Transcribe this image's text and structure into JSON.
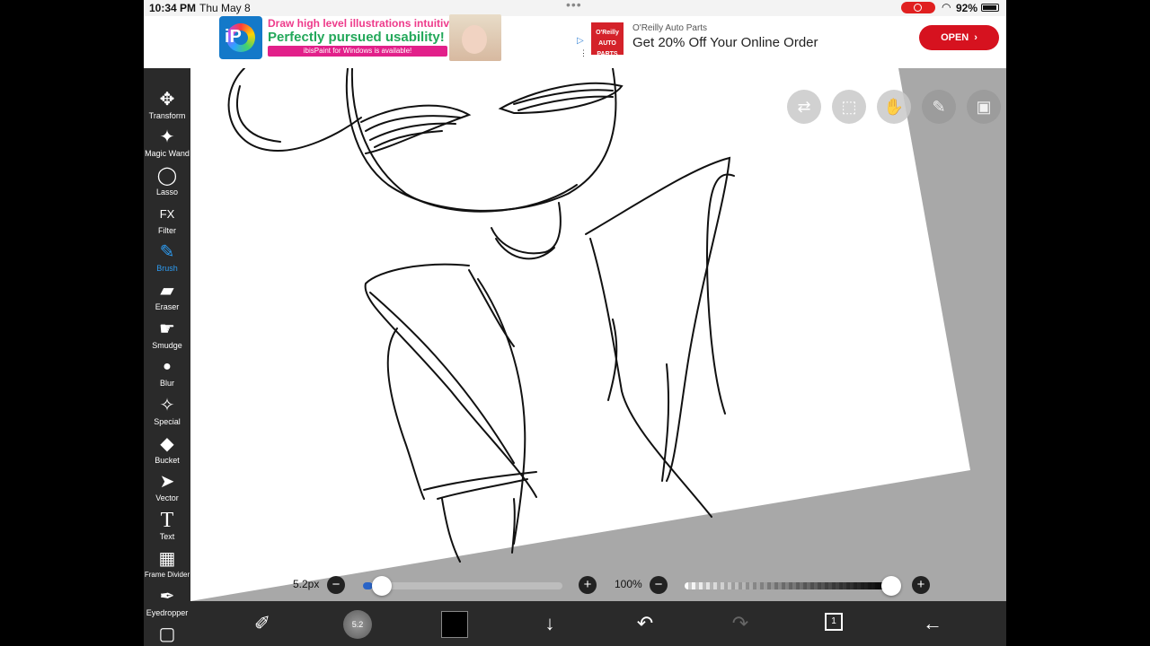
{
  "status_bar": {
    "time": "10:34 PM",
    "date": "Thu May 8",
    "battery": "92%",
    "icons": [
      "screen-record-icon",
      "wifi-icon",
      "battery-icon"
    ]
  },
  "ads": {
    "left": {
      "line1": "Draw high level illustrations intuitively!",
      "line2": "Perfectly pursued usability!",
      "line3": "ibisPaint for Windows is available!",
      "logo_text": "iP"
    },
    "right": {
      "brand": "O'Reilly Auto Parts",
      "offer": "Get 20% Off Your Online Order",
      "button": "OPEN",
      "logo_text": "O'Reilly AUTO PARTS"
    }
  },
  "toolbar": {
    "tools": [
      {
        "label": "Transform",
        "icon": "move-arrows-icon",
        "glyph": "✥"
      },
      {
        "label": "Magic Wand",
        "icon": "magic-wand-icon",
        "glyph": "✦"
      },
      {
        "label": "Lasso",
        "icon": "lasso-icon",
        "glyph": "◯"
      },
      {
        "label": "Filter",
        "icon": "fx-icon",
        "glyph": "FX"
      },
      {
        "label": "Brush",
        "icon": "brush-icon",
        "glyph": "✎",
        "active": true
      },
      {
        "label": "Eraser",
        "icon": "eraser-icon",
        "glyph": "▰"
      },
      {
        "label": "Smudge",
        "icon": "smudge-icon",
        "glyph": "☛"
      },
      {
        "label": "Blur",
        "icon": "blur-drop-icon",
        "glyph": "💧"
      },
      {
        "label": "Special",
        "icon": "special-sparkle-icon",
        "glyph": "✧"
      },
      {
        "label": "Bucket",
        "icon": "bucket-icon",
        "glyph": "◆"
      },
      {
        "label": "Vector",
        "icon": "vector-pointer-icon",
        "glyph": "➤"
      },
      {
        "label": "Text",
        "icon": "text-icon",
        "glyph": "T"
      },
      {
        "label": "Frame Divider",
        "icon": "frame-divider-icon",
        "glyph": "▦"
      },
      {
        "label": "Eyedropper",
        "icon": "eyedropper-icon",
        "glyph": "✒"
      },
      {
        "label": "",
        "icon": "canvas-icon",
        "glyph": "▢"
      }
    ]
  },
  "canvas_buttons": [
    "layer-toggle-icon",
    "selection-icon",
    "hand-touch-icon",
    "ruler-pen-icon",
    "reference-image-icon"
  ],
  "slider_bar": {
    "brush_size": "5.2px",
    "brush_size_fraction": 0.05,
    "opacity": "100%",
    "opacity_fraction": 1.0
  },
  "bottom_bar": {
    "brush_preview_text": "5.2",
    "color": "#000000",
    "layer_count": "1",
    "icons": [
      "brush-settings-icon",
      "brush-preview-icon",
      "color-swatch-icon",
      "download-arrow-icon",
      "undo-icon",
      "redo-icon",
      "layers-icon",
      "back-arrow-icon"
    ]
  },
  "accent_color": "#2d9bf0"
}
